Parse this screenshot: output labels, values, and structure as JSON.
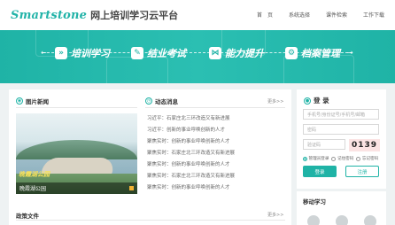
{
  "header": {
    "logo_en": "Smartstone",
    "logo_cn": "网上培训学习云平台",
    "nav": [
      "首　页",
      "系统选择",
      "课件检索",
      "工作下载"
    ]
  },
  "banner": {
    "features": [
      {
        "icon": "book-icon",
        "glyph": "»",
        "label": "培训学习"
      },
      {
        "icon": "exam-icon",
        "glyph": "✎",
        "label": "结业考试"
      },
      {
        "icon": "share-icon",
        "glyph": "⋈",
        "label": "能力提升"
      },
      {
        "icon": "archive-icon",
        "glyph": "⚙",
        "label": "档案管理"
      }
    ]
  },
  "photo_news": {
    "title": "图片新闻",
    "overlay_text": "晚霞湖公园",
    "caption": "晚霞湖公园"
  },
  "news": {
    "title": "动态消息",
    "more": "更多>>",
    "items": [
      "习近平：石家庄北三环改造又有新进展",
      "习近平：创新的事业呼唤创新的人才",
      "聚焦实时：创新的事业呼唤创新的人才",
      "聚焦实时：石家庄北三环改造又有新进展",
      "聚焦实时：创新的事业呼唤创新的人才",
      "聚焦实时：石家庄北三环改造又有新进展",
      "聚焦实时：创新的事业呼唤创新的人才"
    ]
  },
  "policy": {
    "title": "政策文件",
    "more": "更多>>"
  },
  "login": {
    "title": "登 录",
    "username_placeholder": "手机号/身份证号/手机号/邮箱",
    "password_placeholder": "密码",
    "captcha_placeholder": "验证码",
    "captcha_value": "0139",
    "radios": [
      "管理员登录",
      "记住密码",
      "忘记密码"
    ],
    "login_button": "登录",
    "register_button": "注册"
  },
  "mobile": {
    "title": "移动学习"
  },
  "colors": {
    "accent": "#1fb3a6",
    "captcha_bg": "#fbe3e3"
  }
}
